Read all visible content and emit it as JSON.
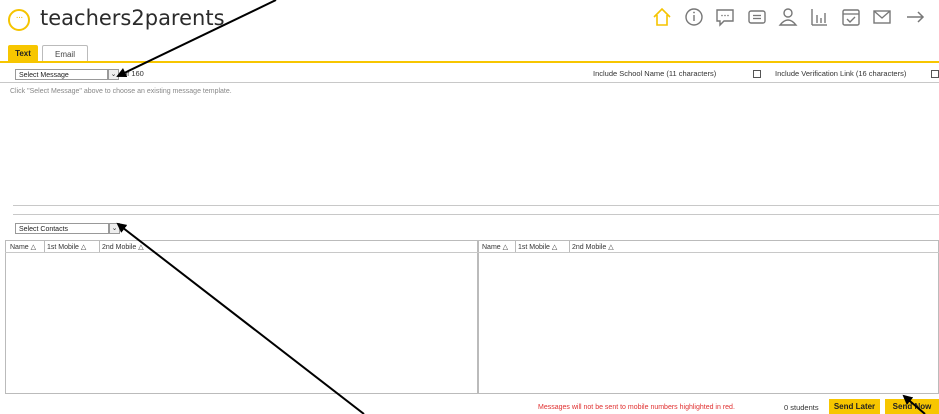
{
  "app": {
    "brand": "teachers2parents",
    "logo_glyph": "···"
  },
  "nav_icons": [
    "home-icon",
    "info-icon",
    "chat-icon",
    "message-icon",
    "user-icon",
    "chart-icon",
    "calendar-check-icon",
    "mail-icon",
    "logout-arrow-icon"
  ],
  "tabs": [
    {
      "label": "Text",
      "active": true
    },
    {
      "label": "Email",
      "active": false
    }
  ],
  "message": {
    "select_placeholder": "Select Message",
    "count": "of 160",
    "hint": "Click \"Select Message\" above to choose an existing message template.",
    "include_school": "Include School Name (11 characters)",
    "include_verification": "Include Verification Link (16 characters)"
  },
  "contacts": {
    "select_placeholder": "Select Contacts",
    "columns": [
      "Name △",
      "1st Mobile △",
      "2nd Mobile △"
    ]
  },
  "footer": {
    "warning": "Messages will not be sent to mobile numbers highlighted in red.",
    "students": "0 students",
    "send_later": "Send Later",
    "send_now": "Send Now"
  },
  "colors": {
    "accent": "#f7c600",
    "warning": "#e03030"
  }
}
